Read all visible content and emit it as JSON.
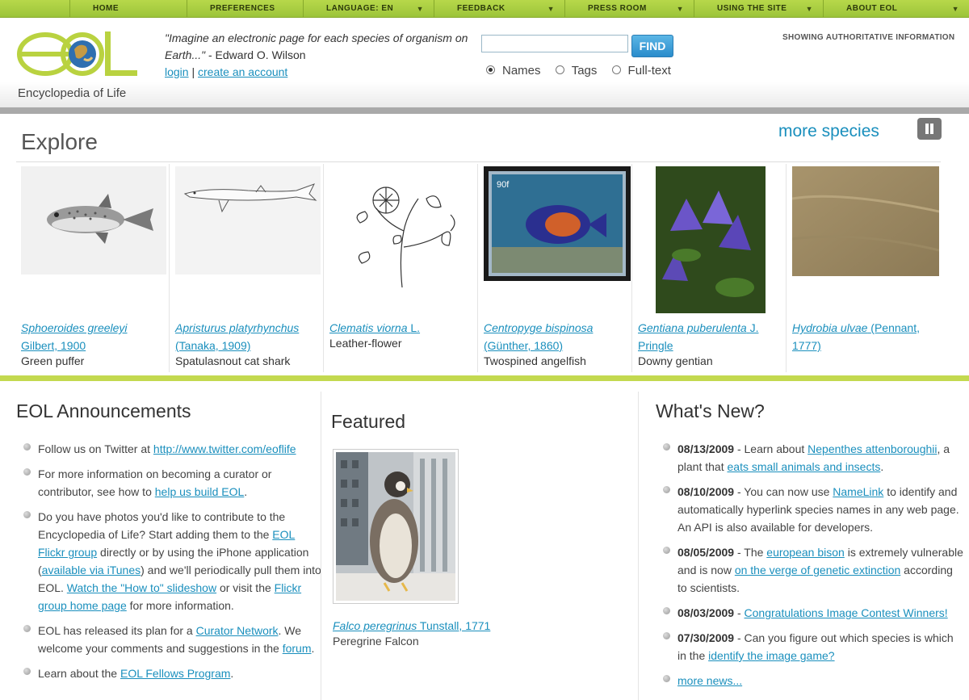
{
  "nav": {
    "items": [
      {
        "label": "HOME",
        "dropdown": false
      },
      {
        "label": "PREFERENCES",
        "dropdown": false
      },
      {
        "label": "LANGUAGE: EN",
        "dropdown": true
      },
      {
        "label": "FEEDBACK",
        "dropdown": true
      },
      {
        "label": "PRESS ROOM",
        "dropdown": true
      },
      {
        "label": "USING THE SITE",
        "dropdown": true
      },
      {
        "label": "ABOUT EOL",
        "dropdown": true
      }
    ],
    "chevron": "▼"
  },
  "header": {
    "logo_letters": "eol",
    "logo_subtitle": "Encyclopedia of Life",
    "quote": "\"Imagine an electronic page for each species of organism on Earth...\"",
    "quote_author": " - Edward O. Wilson",
    "login": "login",
    "separator": " | ",
    "create_account": "create an account",
    "search_value": "",
    "find_label": "FIND",
    "search_options": [
      {
        "label": "Names",
        "selected": true
      },
      {
        "label": "Tags",
        "selected": false
      },
      {
        "label": "Full-text",
        "selected": false
      }
    ],
    "auth_info": "SHOWING AUTHORITATIVE INFORMATION"
  },
  "explore": {
    "title": "Explore",
    "more_species": "more species",
    "species": [
      {
        "sci_name": "Sphoeroides greeleyi",
        "authority": "Gilbert, 1900",
        "common": "Green puffer"
      },
      {
        "sci_name": "Apristurus platyrhynchus",
        "authority": "(Tanaka, 1909)",
        "common": "Spatulasnout cat shark"
      },
      {
        "sci_name": "Clematis viorna",
        "authority": "L.",
        "common": "Leather-flower"
      },
      {
        "sci_name": "Centropyge bispinosa",
        "authority": "(Günther, 1860)",
        "common": "Twospined angelfish"
      },
      {
        "sci_name": "Gentiana puberulenta",
        "authority": "J. Pringle",
        "common": "Downy gentian"
      },
      {
        "sci_name": "Hydrobia ulvae",
        "authority": "(Pennant, 1777)",
        "common": ""
      }
    ],
    "stamp_value": "90f"
  },
  "announcements": {
    "title": "EOL Announcements",
    "items": [
      {
        "pre": "Follow us on Twitter at ",
        "link": "http://www.twitter.com/eoflife",
        "post": ""
      },
      {
        "pre": "For more information on becoming a curator or contributor, see how to ",
        "link": "help us build EOL",
        "post": "."
      },
      {
        "pre": "Do you have photos you'd like to contribute to the Encyclopedia of Life? Start adding them to the ",
        "link": "EOL Flickr group",
        "mid": " directly or by using the iPhone application (",
        "link2": "available via iTunes",
        "mid2": ") and we'll periodically pull them into EOL. ",
        "link3": "Watch the \"How to\" slideshow",
        "mid3": " or visit the ",
        "link4": "Flickr group home page",
        "post": " for more information."
      },
      {
        "pre": "EOL has released its plan for a ",
        "link": "Curator Network",
        "mid": ". We welcome your comments and suggestions in the ",
        "link2": "forum",
        "post": "."
      },
      {
        "pre": "Learn about the ",
        "link": "EOL Fellows Program",
        "post": "."
      }
    ]
  },
  "featured": {
    "title": "Featured",
    "sci_name": "Falco peregrinus",
    "authority": " Tunstall, 1771",
    "common": "Peregrine Falcon"
  },
  "whats_new": {
    "title": "What's New?",
    "items": [
      {
        "date": "08/13/2009",
        "pre": " - Learn about ",
        "link": "Nepenthes attenboroughii",
        "mid": ", a plant that ",
        "link2": "eats small animals and insects",
        "post": "."
      },
      {
        "date": "08/10/2009",
        "pre": " - You can now use ",
        "link": "NameLink",
        "post": " to identify and automatically hyperlink species names in any web page. An API is also available for developers."
      },
      {
        "date": "08/05/2009",
        "pre": " - The ",
        "link": "european bison",
        "mid": " is extremely vulnerable and is now ",
        "link2": "on the verge of genetic extinction",
        "post": " according to scientists."
      },
      {
        "date": "08/03/2009",
        "pre": " - ",
        "link": "Congratulations Image Contest Winners!",
        "post": ""
      },
      {
        "date": "07/30/2009",
        "pre": " - Can you figure out which species is which in the ",
        "link": "identify the image game?",
        "post": ""
      }
    ],
    "more_news": "more news..."
  },
  "colors": {
    "nav_green": "#9cc43a",
    "accent_green": "#c3d94f",
    "link_blue": "#1a8fbd",
    "find_blue": "#2a8ccc"
  }
}
